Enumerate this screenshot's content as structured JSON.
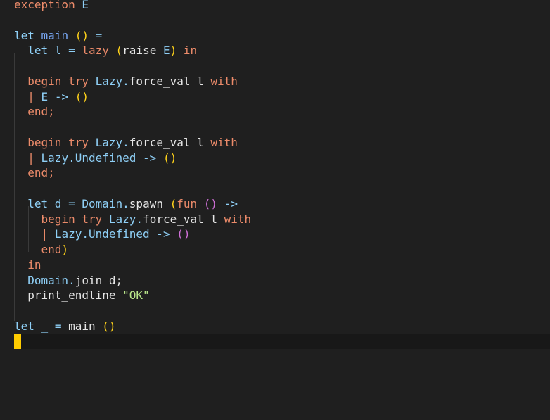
{
  "editor": {
    "lines": [
      [
        [
          "exception",
          "kw"
        ],
        [
          " ",
          "plain"
        ],
        [
          "E",
          "id"
        ]
      ],
      [],
      [
        [
          "let",
          "id"
        ],
        [
          " ",
          "plain"
        ],
        [
          "main",
          "fn"
        ],
        [
          " ",
          "plain"
        ],
        [
          "()",
          "p1"
        ],
        [
          " =",
          "id"
        ]
      ],
      [
        [
          "  ",
          "plain"
        ],
        [
          "let",
          "id"
        ],
        [
          " l ",
          "id"
        ],
        [
          "=",
          "id"
        ],
        [
          " ",
          "plain"
        ],
        [
          "lazy",
          "kw"
        ],
        [
          " ",
          "plain"
        ],
        [
          "(",
          "p1"
        ],
        [
          "raise ",
          "plain"
        ],
        [
          "E",
          "id"
        ],
        [
          ")",
          "p1"
        ],
        [
          " ",
          "plain"
        ],
        [
          "in",
          "kw"
        ]
      ],
      [],
      [
        [
          "  ",
          "plain"
        ],
        [
          "begin",
          "kw"
        ],
        [
          " ",
          "plain"
        ],
        [
          "try",
          "kw"
        ],
        [
          " ",
          "plain"
        ],
        [
          "Lazy.",
          "id"
        ],
        [
          "force_val l ",
          "plain"
        ],
        [
          "with",
          "kw"
        ]
      ],
      [
        [
          "  ",
          "plain"
        ],
        [
          "|",
          "kw"
        ],
        [
          " ",
          "plain"
        ],
        [
          "E",
          "id"
        ],
        [
          " ->",
          "id"
        ],
        [
          " ",
          "plain"
        ],
        [
          "()",
          "p1"
        ]
      ],
      [
        [
          "  ",
          "plain"
        ],
        [
          "end;",
          "kw"
        ]
      ],
      [],
      [
        [
          "  ",
          "plain"
        ],
        [
          "begin",
          "kw"
        ],
        [
          " ",
          "plain"
        ],
        [
          "try",
          "kw"
        ],
        [
          " ",
          "plain"
        ],
        [
          "Lazy.",
          "id"
        ],
        [
          "force_val l ",
          "plain"
        ],
        [
          "with",
          "kw"
        ]
      ],
      [
        [
          "  ",
          "plain"
        ],
        [
          "|",
          "kw"
        ],
        [
          " ",
          "plain"
        ],
        [
          "Lazy.Undefined",
          "id"
        ],
        [
          " ->",
          "id"
        ],
        [
          " ",
          "plain"
        ],
        [
          "()",
          "p1"
        ]
      ],
      [
        [
          "  ",
          "plain"
        ],
        [
          "end;",
          "kw"
        ]
      ],
      [],
      [
        [
          "  ",
          "plain"
        ],
        [
          "let",
          "id"
        ],
        [
          " d ",
          "id"
        ],
        [
          "=",
          "id"
        ],
        [
          " ",
          "plain"
        ],
        [
          "Domain.",
          "id"
        ],
        [
          "spawn ",
          "plain"
        ],
        [
          "(",
          "p1"
        ],
        [
          "fun",
          "kw"
        ],
        [
          " ",
          "plain"
        ],
        [
          "()",
          "p2"
        ],
        [
          " ->",
          "id"
        ]
      ],
      [
        [
          "    ",
          "plain"
        ],
        [
          "begin",
          "kw"
        ],
        [
          " ",
          "plain"
        ],
        [
          "try",
          "kw"
        ],
        [
          " ",
          "plain"
        ],
        [
          "Lazy.",
          "id"
        ],
        [
          "force_val l ",
          "plain"
        ],
        [
          "with",
          "kw"
        ]
      ],
      [
        [
          "    ",
          "plain"
        ],
        [
          "|",
          "kw"
        ],
        [
          " ",
          "plain"
        ],
        [
          "Lazy.Undefined",
          "id"
        ],
        [
          " ->",
          "id"
        ],
        [
          " ",
          "plain"
        ],
        [
          "()",
          "p2"
        ]
      ],
      [
        [
          "    ",
          "plain"
        ],
        [
          "end",
          "kw"
        ],
        [
          ")",
          "p1"
        ]
      ],
      [
        [
          "  ",
          "plain"
        ],
        [
          "in",
          "kw"
        ]
      ],
      [
        [
          "  ",
          "plain"
        ],
        [
          "Domain.",
          "id"
        ],
        [
          "join d;",
          "plain"
        ]
      ],
      [
        [
          "  ",
          "plain"
        ],
        [
          "print_endline ",
          "plain"
        ],
        [
          "\"OK\"",
          "str"
        ]
      ],
      [],
      [
        [
          "let",
          "id"
        ],
        [
          " _ ",
          "id"
        ],
        [
          "=",
          "id"
        ],
        [
          " main ",
          "plain"
        ],
        [
          "()",
          "p1"
        ]
      ]
    ],
    "cursor_color": "#ffcc00"
  }
}
